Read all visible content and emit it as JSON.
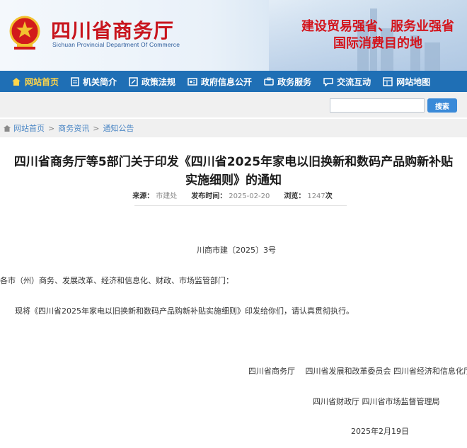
{
  "header": {
    "site_name_cn": "四川省商务厅",
    "site_name_en": "Sichuan Provincial Department Of Commerce",
    "slogan_line1": "建设贸易强省、服务业强省",
    "slogan_line2": "国际消费目的地"
  },
  "nav": {
    "items": [
      {
        "label": "网站首页",
        "icon": "home-icon"
      },
      {
        "label": "机关简介",
        "icon": "document-icon"
      },
      {
        "label": "政策法规",
        "icon": "edit-icon"
      },
      {
        "label": "政府信息公开",
        "icon": "info-icon"
      },
      {
        "label": "政务服务",
        "icon": "service-icon"
      },
      {
        "label": "交流互动",
        "icon": "chat-icon"
      },
      {
        "label": "网站地图",
        "icon": "sitemap-icon"
      }
    ]
  },
  "search": {
    "placeholder": "",
    "button_label": "搜索"
  },
  "breadcrumb": {
    "items": [
      "网站首页",
      "商务资讯",
      "通知公告"
    ],
    "separator": ">"
  },
  "article": {
    "title_line1": "四川省商务厅等5部门关于印发《四川省2025年家电以旧换新和数码产品购新补贴",
    "title_line2": "实施细则》的通知",
    "source_label": "来源：",
    "source_value": "市建处",
    "date_label": "发布时间：",
    "date_value": "2025-02-20",
    "views_label": "浏览：",
    "views_value": "1247",
    "views_unit": "次",
    "doc_number": "川商市建〔2025〕3号",
    "recipients": "各市（州）商务、发展改革、经济和信息化、财政、市场监管部门：",
    "body": "现将《四川省2025年家电以旧换新和数码产品购新补贴实施细则》印发给你们，请认真贯彻执行。",
    "signers_line1": "四川省商务厅　 四川省发展和改革委员会  四川省经济和信息化厅",
    "signers_line2": "四川省财政厅  四川省市场监督管理局",
    "sign_date": "2025年2月19日"
  },
  "colors": {
    "nav_bg": "#1f6fb5",
    "brand_red": "#c8151d",
    "active_nav": "#ffd54a"
  }
}
